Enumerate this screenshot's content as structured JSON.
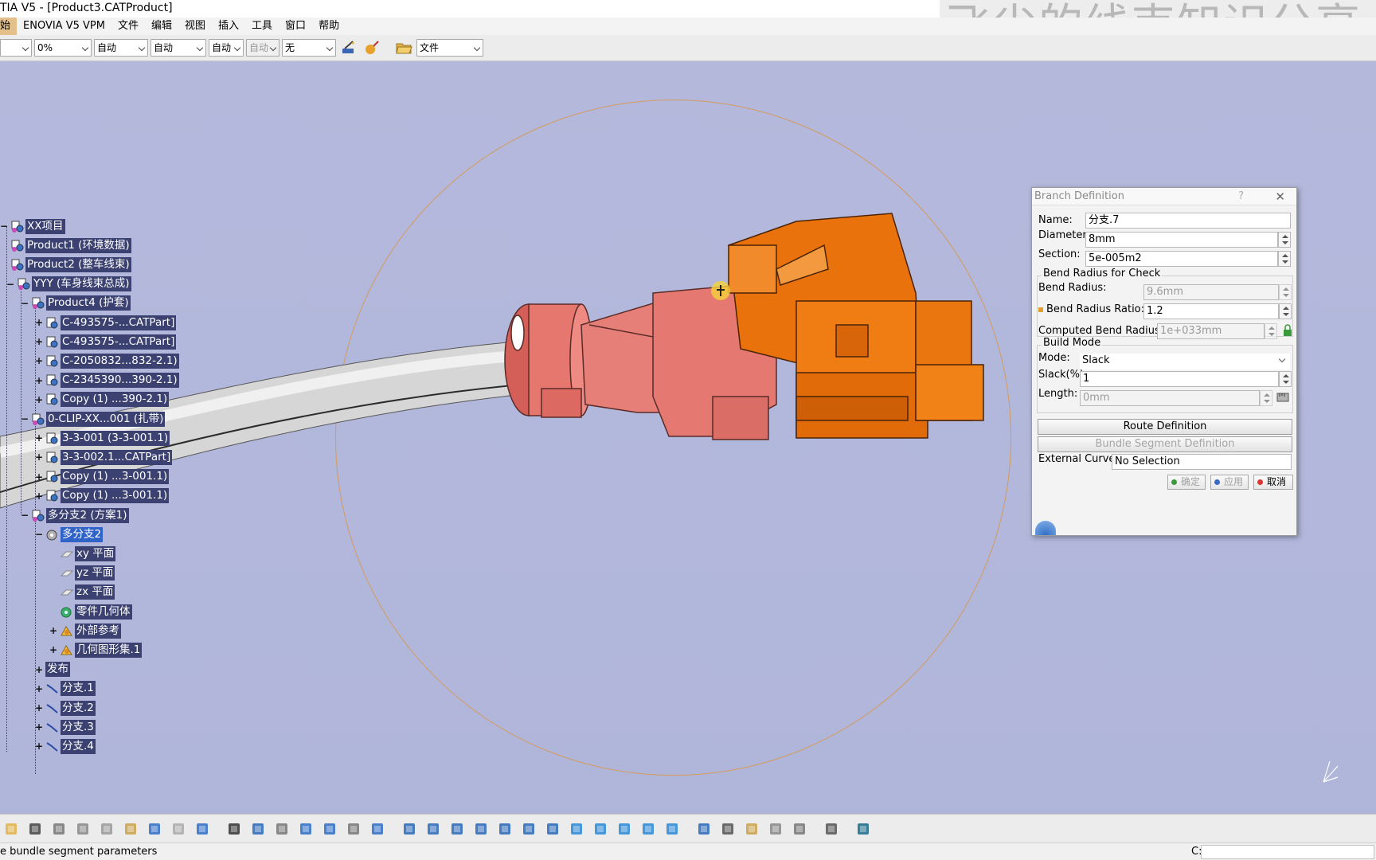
{
  "window": {
    "title": "TIA V5 - [Product3.CATProduct]",
    "watermark": "飞尘的线束知识分享"
  },
  "menu": [
    "始",
    "ENOVIA V5 VPM",
    "文件",
    "编辑",
    "视图",
    "插入",
    "工具",
    "窗口",
    "帮助"
  ],
  "toolbar": {
    "combos": [
      "",
      "0%",
      "自动",
      "自动",
      "自动",
      "自动",
      "无",
      "文件"
    ]
  },
  "tree": [
    {
      "label": "XX项目",
      "expander": "minus",
      "icon": "product-icon"
    },
    {
      "label": "Product1 (环境数据)",
      "expander": "",
      "icon": "product-icon"
    },
    {
      "label": "Product2 (整车线束)",
      "expander": "",
      "icon": "product-icon"
    },
    {
      "label": "YYY (车身线束总成)",
      "expander": "minus",
      "icon": "product-icon"
    },
    {
      "label": "Product4 (护套)",
      "expander": "minus",
      "icon": "product-icon"
    },
    {
      "label": "C-493575-...CATPart]",
      "expander": "plus",
      "icon": "part-icon"
    },
    {
      "label": "C-493575-...CATPart]",
      "expander": "plus",
      "icon": "part-icon"
    },
    {
      "label": "C-2050832...832-2.1)",
      "expander": "plus",
      "icon": "part-icon"
    },
    {
      "label": "C-2345390...390-2.1)",
      "expander": "plus",
      "icon": "part-icon"
    },
    {
      "label": "Copy (1) ...390-2.1)",
      "expander": "plus",
      "icon": "part-icon"
    },
    {
      "label": "0-CLIP-XX...001 (扎带)",
      "expander": "minus",
      "icon": "product-icon"
    },
    {
      "label": "3-3-001 (3-3-001.1)",
      "expander": "plus",
      "icon": "part-icon"
    },
    {
      "label": "3-3-002.1...CATPart]",
      "expander": "plus",
      "icon": "part-icon"
    },
    {
      "label": "Copy (1) ...3-001.1)",
      "expander": "plus",
      "icon": "part-icon"
    },
    {
      "label": "Copy (1) ...3-001.1)",
      "expander": "plus",
      "icon": "part-icon"
    },
    {
      "label": "多分支2 (方案1)",
      "expander": "minus",
      "icon": "product-icon"
    },
    {
      "label": "多分支2",
      "expander": "minus",
      "icon": "gear-part-icon",
      "selected": true
    },
    {
      "label": "xy 平面",
      "expander": "",
      "icon": "plane-icon"
    },
    {
      "label": "yz 平面",
      "expander": "",
      "icon": "plane-icon"
    },
    {
      "label": "zx 平面",
      "expander": "",
      "icon": "plane-icon"
    },
    {
      "label": "零件几何体",
      "expander": "",
      "icon": "body-icon"
    },
    {
      "label": "外部参考",
      "expander": "plus",
      "icon": "geoset-icon"
    },
    {
      "label": "几何图形集.1",
      "expander": "plus",
      "icon": "geoset-icon"
    },
    {
      "label": "发布",
      "expander": "plus",
      "icon": ""
    },
    {
      "label": "分支.1",
      "expander": "plus",
      "icon": "branch-icon"
    },
    {
      "label": "分支.2",
      "expander": "plus",
      "icon": "branch-icon"
    },
    {
      "label": "分支.3",
      "expander": "plus",
      "icon": "branch-icon"
    },
    {
      "label": "分支.4",
      "expander": "plus",
      "icon": "branch-icon"
    }
  ],
  "dialog": {
    "title": "Branch Definition",
    "help": "?",
    "close": "✕",
    "name_label": "Name:",
    "name_value": "分支.7",
    "diameter_label": "Diameter:",
    "diameter_value": "8mm",
    "section_label": "Section:",
    "section_value": "5e-005m2",
    "bend_group": "Bend Radius for Check",
    "bend_radius_label": "Bend Radius:",
    "bend_radius_value": "9.6mm",
    "bend_ratio_label": "Bend Radius Ratio:",
    "bend_ratio_value": "1.2",
    "computed_label": "Computed Bend Radius:",
    "computed_value": "1e+033mm",
    "build_group": "Build Mode",
    "mode_label": "Mode:",
    "mode_value": "Slack",
    "slack_label": "Slack(%):",
    "slack_value": "1",
    "length_label": "Length:",
    "length_value": "0mm",
    "route_button": "Route Definition",
    "bundle_button": "Bundle Segment Definition",
    "external_label": "External Curve:",
    "external_value": "No Selection",
    "ok": "确定",
    "apply": "应用",
    "cancel": "取消"
  },
  "status": {
    "message": "e bundle segment parameters",
    "drive": "C:"
  },
  "colors": {
    "background": "#b2b7db",
    "connector_orange": "#e9720c",
    "grommet_pink": "#e6766d",
    "tree_label": "#3b4170",
    "selected": "#2f63c8"
  }
}
